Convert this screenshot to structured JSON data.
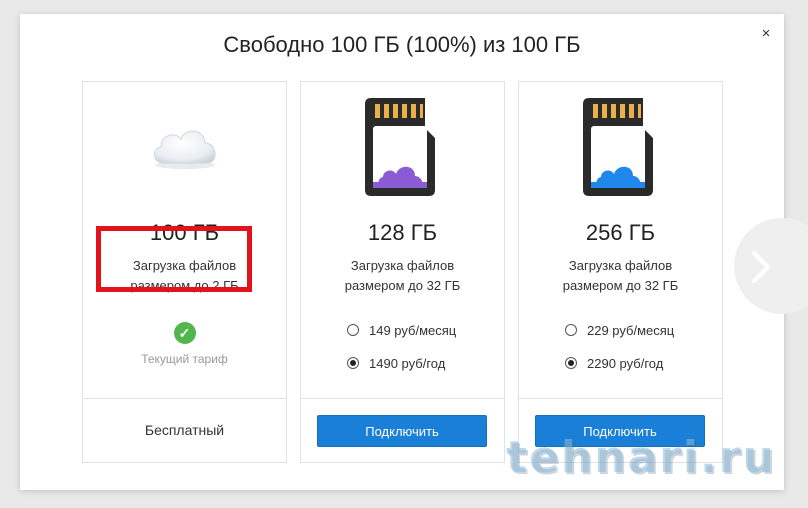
{
  "dialog": {
    "title": "Свободно 100 ГБ (100%) из 100 ГБ",
    "close_label": "×"
  },
  "plans": [
    {
      "size": "100 ГБ",
      "desc_line1": "Загрузка файлов",
      "desc_line2": "размером до 2 ГБ",
      "status_icon": "check-icon",
      "status_label": "Текущий тариф",
      "footer_label": "Бесплатный",
      "image": "cloud-icon"
    },
    {
      "size": "128 ГБ",
      "desc_line1": "Загрузка файлов",
      "desc_line2": "размером до 32 ГБ",
      "image": "sd-card-icon",
      "cloud_color": "#8b5bd6",
      "options": [
        {
          "label": "149 руб/месяц",
          "selected": false
        },
        {
          "label": "1490 руб/год",
          "selected": true
        }
      ],
      "button_label": "Подключить"
    },
    {
      "size": "256 ГБ",
      "desc_line1": "Загрузка файлов",
      "desc_line2": "размером до 32 ГБ",
      "image": "sd-card-icon",
      "cloud_color": "#1f88ea",
      "options": [
        {
          "label": "229 руб/месяц",
          "selected": false
        },
        {
          "label": "2290 руб/год",
          "selected": true
        }
      ],
      "button_label": "Подключить"
    }
  ],
  "watermark": "tehnari.ru",
  "colors": {
    "accent": "#1a7fd6",
    "highlight": "#e3131b",
    "success": "#51b64b"
  }
}
